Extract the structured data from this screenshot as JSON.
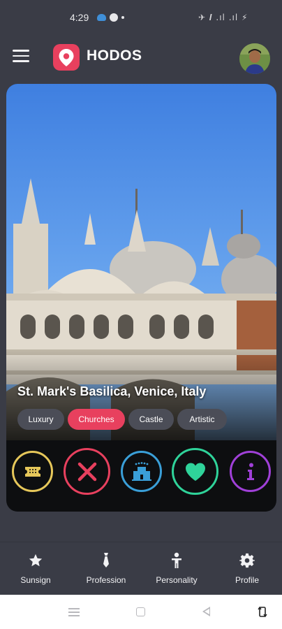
{
  "status_bar": {
    "time": "4:29",
    "right_icons": "✈ 𝑰 .ıl .ıl ⚡"
  },
  "app_bar": {
    "title": "HODOS",
    "menu_icon": "hamburger-menu-icon",
    "logo_icon": "map-pin-icon",
    "avatar": "user-avatar"
  },
  "card": {
    "caption": "St. Mark's Basilica, Venice, Italy",
    "image": "venice-basilica-photo",
    "tags": [
      {
        "label": "Luxury",
        "active": false
      },
      {
        "label": "Churches",
        "active": true
      },
      {
        "label": "Castle",
        "active": false
      },
      {
        "label": "Artistic",
        "active": false
      }
    ],
    "actions": [
      {
        "icon": "ticket-icon",
        "color": "#e6c75a"
      },
      {
        "icon": "close-icon",
        "color": "#e8405e"
      },
      {
        "icon": "hotel-icon",
        "color": "#3a9fd8"
      },
      {
        "icon": "heart-icon",
        "color": "#2fd39a"
      },
      {
        "icon": "info-icon",
        "color": "#a040d8"
      }
    ]
  },
  "bottom_nav": {
    "items": [
      {
        "label": "Sunsign",
        "icon": "star-icon"
      },
      {
        "label": "Profession",
        "icon": "tie-icon"
      },
      {
        "label": "Personality",
        "icon": "person-icon"
      },
      {
        "label": "Profile",
        "icon": "gear-icon"
      }
    ]
  },
  "colors": {
    "background": "#3a3c46",
    "accent": "#e8405e",
    "tag": "#4b4d57"
  }
}
